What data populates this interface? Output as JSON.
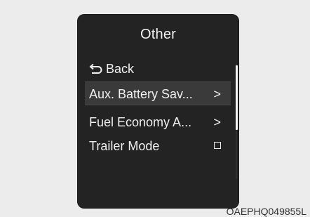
{
  "screen": {
    "title": "Other",
    "back": {
      "icon": "back-arrow-icon",
      "label": "Back"
    },
    "items": [
      {
        "label": "Aux. Battery Sav...",
        "indicator": ">",
        "selected": true
      },
      {
        "label": "Fuel Economy A...",
        "indicator": ">",
        "selected": false
      },
      {
        "label": "Trailer Mode",
        "indicator": "checkbox",
        "checked": false,
        "selected": false
      }
    ],
    "scroll_position": 0.1
  },
  "image_code": "OAEPHQ049855L",
  "colors": {
    "page_bg": "#ececec",
    "screen_bg": "#232323",
    "selected_bg": "#3a3a3a",
    "text": "#f0f0f0"
  }
}
